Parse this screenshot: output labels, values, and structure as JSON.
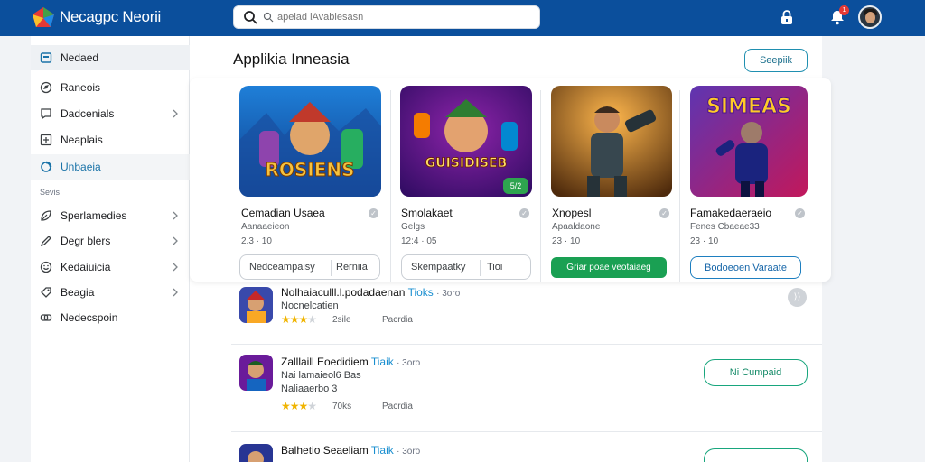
{
  "header": {
    "brand": "Necagpc Neorii",
    "search_placeholder": "apeiad lAvabiesasn",
    "notification_count": "1",
    "colors": {
      "bar": "#0b4f9c",
      "accent": "#1a73a8",
      "green": "#1aa053"
    }
  },
  "sidebar": {
    "items": [
      {
        "label": "Nedaed",
        "icon": "home-icon"
      },
      {
        "label": "Raneois",
        "icon": "compass-icon"
      },
      {
        "label": "Dadcenials",
        "icon": "chat-icon"
      },
      {
        "label": "Neaplais",
        "icon": "plus-square-icon"
      },
      {
        "label": "Unbaeia",
        "icon": "circle-icon"
      },
      {
        "label": "Sperlamedies",
        "icon": "leaf-icon"
      },
      {
        "label": "Degr blers",
        "icon": "pencil-icon"
      },
      {
        "label": "Kedaiuicia",
        "icon": "smile-icon"
      },
      {
        "label": "Beagia",
        "icon": "tag-icon"
      },
      {
        "label": "Nedecspoin",
        "icon": "link-icon"
      }
    ],
    "section_label": "Sevis"
  },
  "main": {
    "title": "Applikia Inneasia",
    "see_all": "Seepiik",
    "featured": [
      {
        "name": "Cemadian Usaea",
        "sub": "Aanaaeieon",
        "rating": "2.3 · 10",
        "art_text": "ROSIENS",
        "btn_left": "Nedceampaisy",
        "btn_right": "Rerniia"
      },
      {
        "name": "Smolakaet",
        "sub": "Gelgs",
        "rating": "12:4 · 05",
        "art_text": "GUISIDISEB",
        "badge": "5/2",
        "btn_left": "Skempaatky",
        "btn_right": "Tioi"
      },
      {
        "name": "Xnopesl",
        "sub": "Apaaldaone",
        "rating": "23 · 10",
        "btn_full": "Griar poae veotaiaeg"
      },
      {
        "name": "Famakedaeraeio",
        "sub": "Fenes Cbaeae33",
        "rating": "23 · 10",
        "art_text": "SIMEAS",
        "btn_full": "Bodoeoen Varaate"
      }
    ],
    "list": [
      {
        "title": "Nolhaiaculll.l.podadaenan",
        "tag": "Tioks",
        "tail": "· 3oro",
        "sub": "Nocnelcatien",
        "meta1": "2sile",
        "meta2": "Pacrdia",
        "stars": 4
      },
      {
        "title": "Zalllaill Eoedidiem",
        "tag": "Tiaik",
        "tail": "· 3oro",
        "sub": "Nai lamaieol6 Bas",
        "sub2": "Naliaaerbo 3",
        "meta1": "70ks",
        "meta2": "Pacrdia",
        "stars": 4,
        "action": "Ni Cumpaid"
      },
      {
        "title": "Balhetio Seaeliam",
        "tag": "Tiaik",
        "tail": "· 3oro"
      }
    ]
  }
}
